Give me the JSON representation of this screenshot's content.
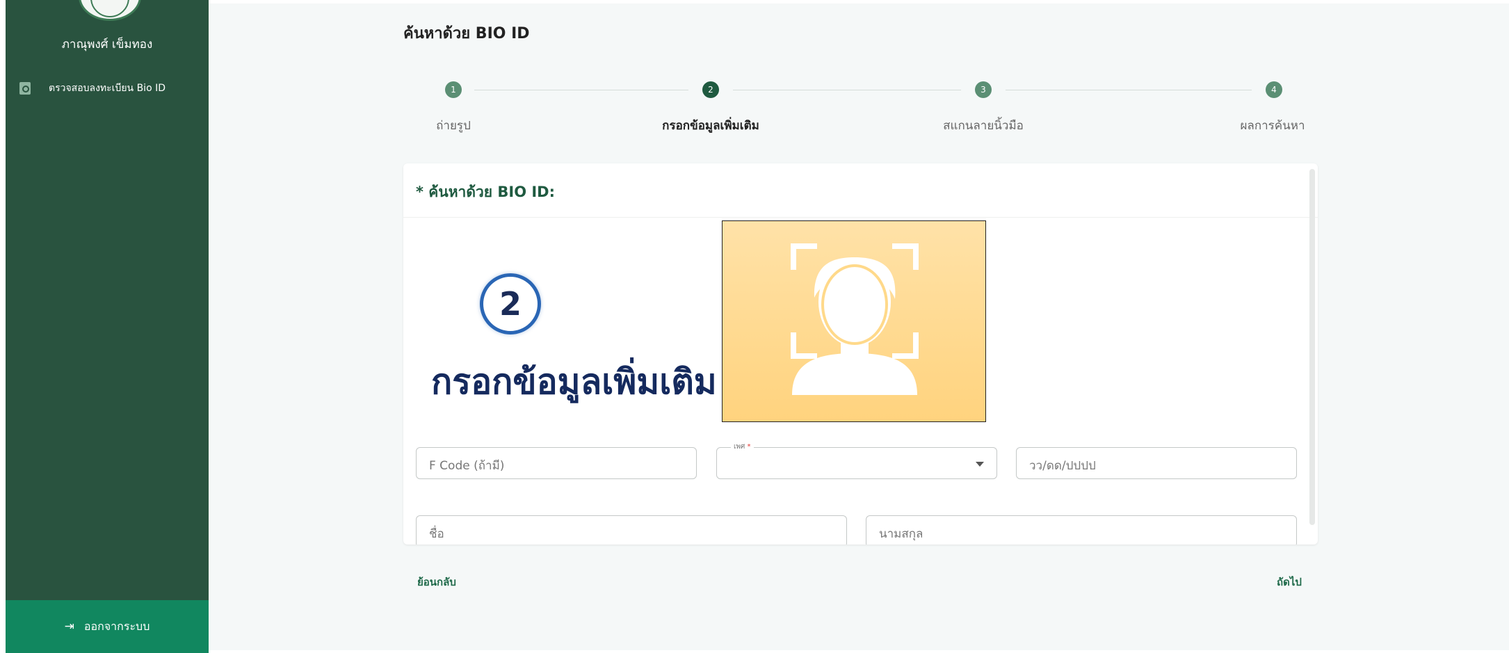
{
  "sidebar": {
    "user_name": "ภาณุพงศ์ เข็มทอง",
    "menu": [
      {
        "label": "ตรวจสอบลงทะเบียน Bio ID",
        "icon": "document-search-icon"
      }
    ],
    "logout_label": "ออกจากระบบ",
    "logout_icon": "logout-icon"
  },
  "main": {
    "page_title": "ค้นหาด้วย BIO ID",
    "steps": [
      {
        "number": "1",
        "label": "ถ่ายรูป",
        "active": false
      },
      {
        "number": "2",
        "label": "กรอกข้อมูลเพิ่มเติม",
        "active": true
      },
      {
        "number": "3",
        "label": "สแกนลายนิ้วมือ",
        "active": false
      },
      {
        "number": "4",
        "label": "ผลการค้นหา",
        "active": false
      }
    ],
    "card": {
      "title_star": "*",
      "title": "ค้นหาด้วย BIO ID:",
      "overlay_number": "2",
      "overlay_text": "กรอกข้อมูลเพิ่มเติม"
    },
    "form": {
      "fcode_placeholder": "F Code (ถ้ามี)",
      "gender_label": "เพศ",
      "gender_required": "*",
      "dob_placeholder": "วว/ดด/ปปปป",
      "firstname_placeholder": "ชื่อ",
      "lastname_placeholder": "นามสกุล"
    },
    "back_label": "ย้อนกลับ",
    "next_label": "ถัดไป"
  },
  "colors": {
    "sidebar": "#29533f",
    "logout_bg": "#11875f",
    "accent": "#1f5a40",
    "overlay_blue": "#2a66b5",
    "photo_bg": "#ffd98a"
  }
}
